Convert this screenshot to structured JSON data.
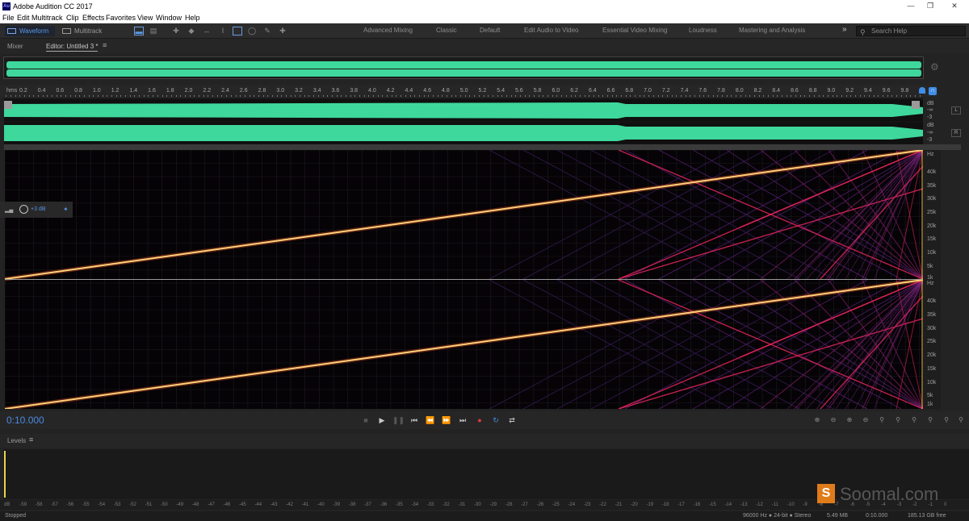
{
  "window": {
    "title": "Adobe Audition CC 2017",
    "logo": "Au"
  },
  "menu": [
    "File",
    "Edit",
    "Multitrack",
    "Clip",
    "Effects",
    "Favorites",
    "View",
    "Window",
    "Help"
  ],
  "toolbar": {
    "modes": [
      "Waveform",
      "Multitrack"
    ],
    "workspaces": [
      "Advanced Mixing",
      "Classic",
      "Default",
      "Edit Audio to Video",
      "Essential Video Mixing",
      "Loudness",
      "Mastering and Analysis"
    ],
    "overflow": "»",
    "search_placeholder": "Search Help"
  },
  "panels": {
    "mixer": "Mixer",
    "editor": "Editor: Untitled 3 *",
    "levels": "Levels"
  },
  "ruler": {
    "unit": "hms",
    "ticks": [
      "0.2",
      "0.4",
      "0.6",
      "0.8",
      "1.0",
      "1.2",
      "1.4",
      "1.6",
      "1.8",
      "2.0",
      "2.2",
      "2.4",
      "2.6",
      "2.8",
      "3.0",
      "3.2",
      "3.4",
      "3.6",
      "3.8",
      "4.0",
      "4.2",
      "4.4",
      "4.6",
      "4.8",
      "5.0",
      "5.2",
      "5.4",
      "5.6",
      "5.8",
      "6.0",
      "6.2",
      "6.4",
      "6.6",
      "6.8",
      "7.0",
      "7.2",
      "7.4",
      "7.6",
      "7.8",
      "8.0",
      "8.2",
      "8.4",
      "8.6",
      "8.8",
      "9.0",
      "9.2",
      "9.4",
      "9.6",
      "9.8",
      "10"
    ]
  },
  "waveform_scale": [
    "dB",
    "-∞",
    "-3",
    "dB",
    "-∞",
    "-3"
  ],
  "channels": [
    "L",
    "R"
  ],
  "spectral_scale": [
    "Hz",
    "40k",
    "35k",
    "30k",
    "25k",
    "20k",
    "15k",
    "10k",
    "5k",
    "1k"
  ],
  "hud": {
    "gain": "+3 dB"
  },
  "transport": {
    "time": "0:10.000"
  },
  "level_scale": [
    "dB",
    "-59",
    "-58",
    "-57",
    "-56",
    "-55",
    "-54",
    "-53",
    "-52",
    "-51",
    "-50",
    "-49",
    "-48",
    "-47",
    "-46",
    "-45",
    "-44",
    "-43",
    "-42",
    "-41",
    "-40",
    "-39",
    "-38",
    "-37",
    "-36",
    "-35",
    "-34",
    "-33",
    "-32",
    "-31",
    "-30",
    "-29",
    "-28",
    "-27",
    "-26",
    "-25",
    "-24",
    "-23",
    "-22",
    "-21",
    "-20",
    "-19",
    "-18",
    "-17",
    "-16",
    "-15",
    "-14",
    "-13",
    "-12",
    "-11",
    "-10",
    "-9",
    "-8",
    "-7",
    "-6",
    "-5",
    "-4",
    "-3",
    "-2",
    "-1",
    "0"
  ],
  "watermark": {
    "letter": "S",
    "text": "Soomal.com"
  },
  "status": {
    "state": "Stopped",
    "format": "96000 Hz ● 24-bit ● Stereo",
    "size": "5.49 MB",
    "duration": "0:10.000",
    "free": "185.13 GB free"
  },
  "colors": {
    "waveform": "#3ed79c",
    "accent": "#4a8ae0",
    "record": "#e43a3a",
    "sweep": "#ffd27a"
  }
}
